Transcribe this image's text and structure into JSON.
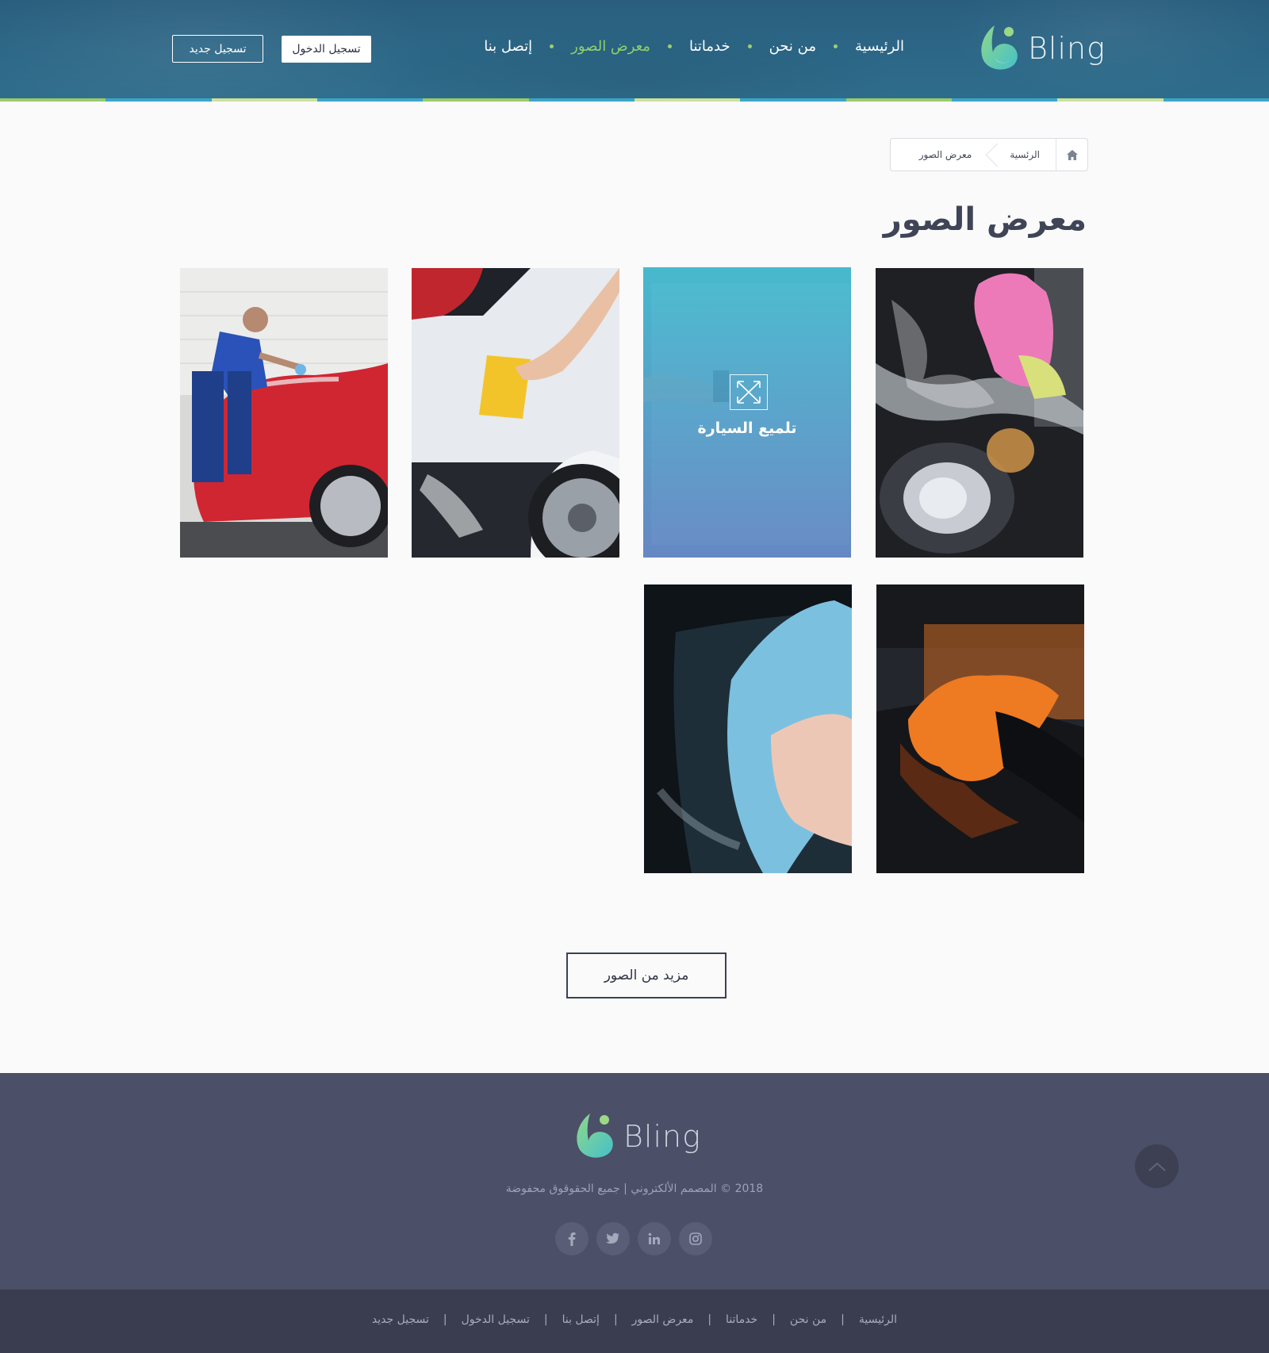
{
  "header": {
    "logo_text": "Bling",
    "nav": [
      {
        "label": "الرئيسية",
        "active": false
      },
      {
        "label": "من نحن",
        "active": false
      },
      {
        "label": "خدماتنا",
        "active": false
      },
      {
        "label": "معرض الصور",
        "active": true
      },
      {
        "label": "إتصل بنا",
        "active": false
      }
    ],
    "login_label": "تسجيل الدخول",
    "register_label": "تسجيل جديد"
  },
  "breadcrumb": {
    "home_icon": "home-icon",
    "items": [
      "الرئسية",
      "معرض الصور"
    ]
  },
  "page_title": "معرض الصور",
  "gallery": {
    "hovered_title": "تلميع السيارة",
    "expand_icon": "expand-icon",
    "images": [
      "car-headlight-pink-glove",
      "car-window-squeegee",
      "white-car-yellow-sponge",
      "man-washing-red-car",
      "orange-cloth-black-car",
      "blue-cloth-mirror"
    ]
  },
  "more_button_label": "مزيد من الصور",
  "footer": {
    "logo_text": "Bling",
    "copyright": "2018 © المصمم الألكتروني | جميع الحقوقوق محفوضة",
    "social_icons": [
      "instagram-icon",
      "linkedin-icon",
      "twitter-icon",
      "facebook-icon"
    ],
    "back_to_top_icon": "chevron-up-icon",
    "links": [
      "الرئيسية",
      "من نحن",
      "خدماتنا",
      "معرض الصور",
      "إتصل بنا",
      "تسجيل الدخول",
      "تسجيل جديد"
    ]
  },
  "colors": {
    "header_bg": "#2c6787",
    "accent_green": "#8fd06b",
    "title_text": "#3f4557",
    "footer_bg": "#4b4f67",
    "bottom_bar_bg": "#3a3d50",
    "overlay_top": "#40bcd0",
    "overlay_bottom": "#6284c4"
  }
}
